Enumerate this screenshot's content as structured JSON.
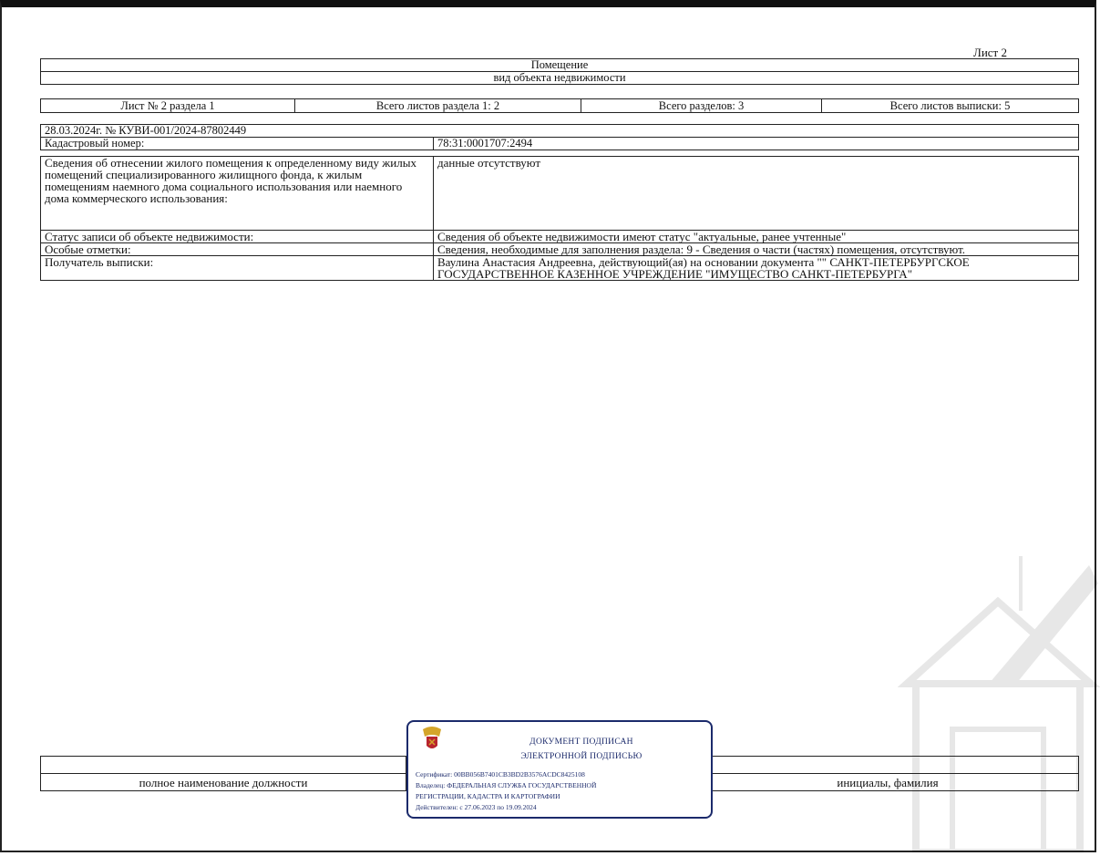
{
  "sheet_label": "Лист 2",
  "header": {
    "title": "Помещение",
    "subtitle": "вид объекта недвижимости"
  },
  "sheets_row": [
    "Лист № 2 раздела 1",
    "Всего листов раздела 1: 2",
    "Всего разделов: 3",
    "Всего листов выписки: 5"
  ],
  "record": {
    "date_number": "28.03.2024г. № КУВИ-001/2024-87802449",
    "cadastral_label": "Кадастровый номер:",
    "cadastral_value": "78:31:0001707:2494"
  },
  "rows": [
    {
      "label": "Сведения об отнесении жилого помещения к определенному виду жилых помещений специализированного жилищного фонда, к жилым помещениям наемного дома социального использования или наемного дома коммерческого использования:",
      "value": "данные отсутствуют"
    },
    {
      "label": "Статус записи об объекте недвижимости:",
      "value": "Сведения об объекте недвижимости имеют статус \"актуальные, ранее учтенные\""
    },
    {
      "label": "Особые отметки:",
      "value": "Сведения, необходимые для заполнения раздела: 9 - Сведения о части (частях) помещения, отсутствуют."
    },
    {
      "label": "Получатель выписки:",
      "value": "Ваулина Анастасия Андреевна, действующий(ая) на основании документа \"\" САНКТ-ПЕТЕРБУРГСКОЕ ГОСУДАРСТВЕННОЕ КАЗЕННОЕ УЧРЕЖДЕНИЕ \"ИМУЩЕСТВО САНКТ-ПЕТЕРБУРГА\""
    }
  ],
  "signature": {
    "position_label": "полное наименование должности",
    "name_label": "инициалы, фамилия"
  },
  "stamp": {
    "title_line1": "ДОКУМЕНТ ПОДПИСАН",
    "title_line2": "ЭЛЕКТРОННОЙ ПОДПИСЬЮ",
    "certificate": "Сертификат: 00BB056B7401CB3BD2B3576ACDC8425108",
    "owner_line1": "Владелец: ФЕДЕРАЛЬНАЯ СЛУЖБА ГОСУДАРСТВЕННОЙ",
    "owner_line2": "РЕГИСТРАЦИИ, КАДАСТРА И КАРТОГРАФИИ",
    "valid": "Действителен: с 27.06.2023 по 19.09.2024"
  },
  "colors": {
    "stamp": "#1b2a6b",
    "emblem_red": "#b8252e",
    "emblem_gold": "#d4a52a"
  }
}
